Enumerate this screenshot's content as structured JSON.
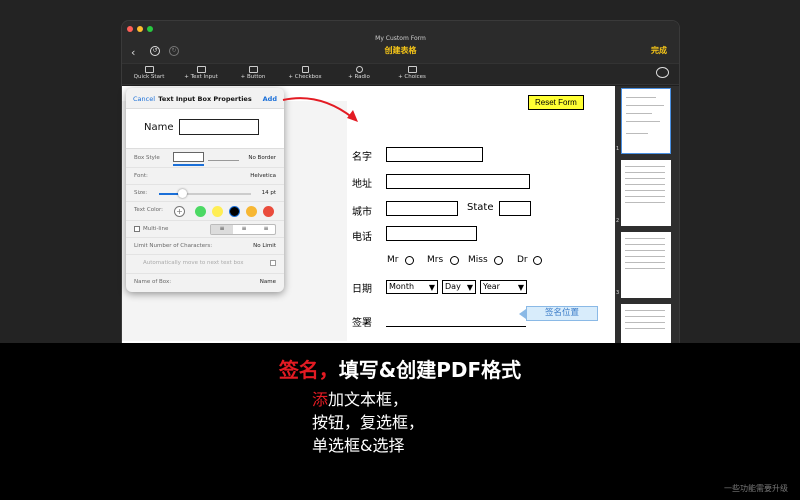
{
  "window": {
    "app_title": "My Custom Form",
    "doc_title": "创建表格",
    "done_label": "完成"
  },
  "toolbar": {
    "items": [
      {
        "label": "Quick Start"
      },
      {
        "label": "+ Text Input"
      },
      {
        "label": "+ Button"
      },
      {
        "label": "+ Checkbox"
      },
      {
        "label": "+ Radio"
      },
      {
        "label": "+ Choices"
      }
    ]
  },
  "form": {
    "reset_label": "Reset Form",
    "name_label": "名字",
    "address_label": "地址",
    "city_label": "城市",
    "state_label": "State",
    "phone_label": "电话",
    "radio_options": [
      "Mr",
      "Mrs",
      "Miss",
      "Dr"
    ],
    "date_label": "日期",
    "month": "Month",
    "day": "Day",
    "year": "Year",
    "sign_label": "签署",
    "sign_tag": "签名位置"
  },
  "popover": {
    "cancel": "Cancel",
    "title": "Text Input Box Properties",
    "add": "Add",
    "name_label": "Name",
    "box_style_label": "Box Style",
    "no_border": "No Border",
    "font_label": "Font:",
    "font_value": "Helvetica",
    "size_label": "Size:",
    "size_value": "14 pt",
    "size_level": 0.25,
    "text_color_label": "Text Color:",
    "colors": [
      "#4cd964",
      "#ffee55",
      "#000000",
      "#f7b733",
      "#ea4c3c"
    ],
    "multiline_label": "Multi-line",
    "limit_label": "Limit Number of Characters:",
    "limit_value": "No Limit",
    "auto_move_label": "Automatically move to next text box",
    "name_of_box_label": "Name of Box:",
    "name_of_box_value": "Name"
  },
  "thumbnails": {
    "pages": [
      "1",
      "2",
      "3"
    ]
  },
  "caption": {
    "main_red": "签名，",
    "main_white": "填写&创建PDF格式",
    "line1_red": "添",
    "line1_white": "加文本框，",
    "line2": "按钮，复选框，",
    "line3": "单选框&选择",
    "footnote": "一些功能需要升级"
  }
}
